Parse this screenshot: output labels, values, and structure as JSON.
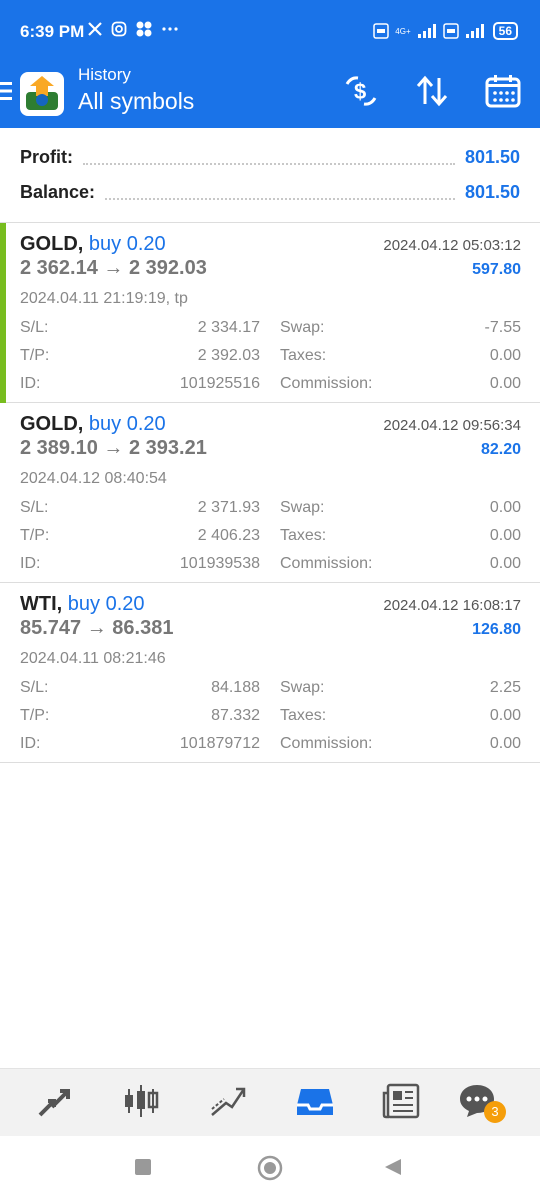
{
  "status_bar": {
    "time": "6:39 PM",
    "battery": "56",
    "network_label": "4G+"
  },
  "app_bar": {
    "subtitle": "History",
    "title": "All symbols"
  },
  "summary": {
    "profit_label": "Profit:",
    "profit_value": "801.50",
    "balance_label": "Balance:",
    "balance_value": "801.50"
  },
  "deals": [
    {
      "symbol": "GOLD,",
      "side": "buy 0.20",
      "close_time": "2024.04.12 05:03:12",
      "prices": "2 362.14 → 2 392.03",
      "profit": "597.80",
      "open_time": "2024.04.11 21:19:19, tp",
      "sl_label": "S/L:",
      "sl": "2 334.17",
      "tp_label": "T/P:",
      "tp": "2 392.03",
      "id_label": "ID:",
      "id": "101925516",
      "swap_label": "Swap:",
      "swap": "-7.55",
      "taxes_label": "Taxes:",
      "taxes": "0.00",
      "commission_label": "Commission:",
      "commission": "0.00"
    },
    {
      "symbol": "GOLD,",
      "side": "buy 0.20",
      "close_time": "2024.04.12 09:56:34",
      "prices": "2 389.10 → 2 393.21",
      "profit": "82.20",
      "open_time": "2024.04.12 08:40:54",
      "sl_label": "S/L:",
      "sl": "2 371.93",
      "tp_label": "T/P:",
      "tp": "2 406.23",
      "id_label": "ID:",
      "id": "101939538",
      "swap_label": "Swap:",
      "swap": "0.00",
      "taxes_label": "Taxes:",
      "taxes": "0.00",
      "commission_label": "Commission:",
      "commission": "0.00"
    },
    {
      "symbol": "WTI,",
      "side": "buy 0.20",
      "close_time": "2024.04.12 16:08:17",
      "prices": "85.747 → 86.381",
      "profit": "126.80",
      "open_time": "2024.04.11 08:21:46",
      "sl_label": "S/L:",
      "sl": "84.188",
      "tp_label": "T/P:",
      "tp": "87.332",
      "id_label": "ID:",
      "id": "101879712",
      "swap_label": "Swap:",
      "swap": "2.25",
      "taxes_label": "Taxes:",
      "taxes": "0.00",
      "commission_label": "Commission:",
      "commission": "0.00"
    }
  ],
  "bottom_nav": {
    "items": [
      "quotes-icon",
      "chart-icon",
      "trade-icon",
      "history-icon",
      "news-icon",
      "chat-icon"
    ],
    "active": "history-icon",
    "chat_badge": "3"
  },
  "colors": {
    "accent": "#1a73e8",
    "profit_bar": "#78bd1f",
    "badge": "#f59e0b"
  }
}
